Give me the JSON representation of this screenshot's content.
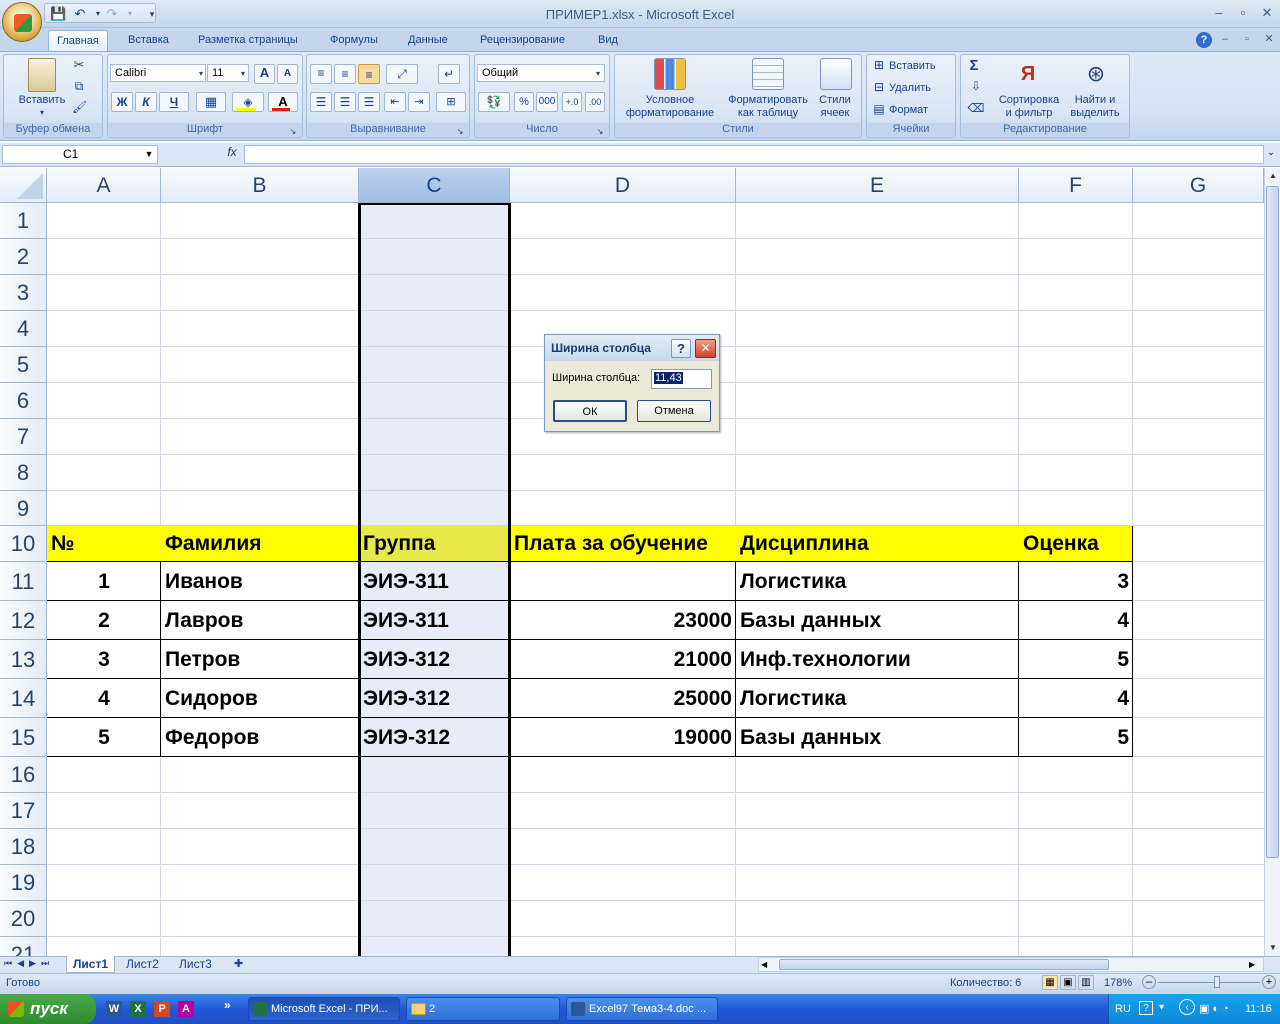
{
  "window": {
    "title": "ПРИМЕР1.xlsx - Microsoft Excel"
  },
  "ribbon": {
    "tabs": [
      "Главная",
      "Вставка",
      "Разметка страницы",
      "Формулы",
      "Данные",
      "Рецензирование",
      "Вид"
    ],
    "clipboard": {
      "paste": "Вставить",
      "label": "Буфер обмена"
    },
    "font": {
      "name": "Calibri",
      "size": "11",
      "bold": "Ж",
      "italic": "К",
      "underline": "Ч",
      "grow": "A",
      "shrink": "A",
      "color_letter": "A",
      "label": "Шрифт"
    },
    "alignment": {
      "label": "Выравнивание"
    },
    "number": {
      "format": "Общий",
      "percent": "%",
      "thousands": "000",
      "label": "Число"
    },
    "styles": {
      "conditional_1": "Условное",
      "conditional_2": "форматирование",
      "table_1": "Форматировать",
      "table_2": "как таблицу",
      "cell_1": "Стили",
      "cell_2": "ячеек",
      "label": "Стили"
    },
    "cells": {
      "insert": "Вставить",
      "delete": "Удалить",
      "format": "Формат",
      "label": "Ячейки"
    },
    "editing": {
      "sum": "Σ",
      "sort_1": "Сортировка",
      "sort_2": "и фильтр",
      "find_1": "Найти и",
      "find_2": "выделить",
      "label": "Редактирование"
    }
  },
  "formula_bar": {
    "name_box": "C1",
    "fx": "fx",
    "formula": ""
  },
  "columns": [
    "A",
    "B",
    "C",
    "D",
    "E",
    "F",
    "G"
  ],
  "rows": [
    "1",
    "2",
    "3",
    "4",
    "5",
    "6",
    "7",
    "8",
    "9",
    "10",
    "11",
    "12",
    "13",
    "14",
    "15",
    "16",
    "17",
    "18",
    "19",
    "20",
    "21"
  ],
  "table": {
    "headers": [
      "№",
      "Фамилия",
      "Группа",
      "Плата за обучение",
      "Дисциплина",
      "Оценка"
    ],
    "rows": [
      [
        "1",
        "Иванов",
        "ЭИЭ-311",
        "",
        "Логистика",
        "3"
      ],
      [
        "2",
        "Лавров",
        "ЭИЭ-311",
        "23000",
        "Базы данных",
        "4"
      ],
      [
        "3",
        "Петров",
        "ЭИЭ-312",
        "21000",
        "Инф.технологии",
        "5"
      ],
      [
        "4",
        "Сидоров",
        "ЭИЭ-312",
        "25000",
        "Логистика",
        "4"
      ],
      [
        "5",
        "Федоров",
        "ЭИЭ-312",
        "19000",
        "Базы данных",
        "5"
      ]
    ]
  },
  "dialog": {
    "title": "Ширина столбца",
    "help": "?",
    "close": "✕",
    "field_label": "Ширина столбца:",
    "field_value": "11,43",
    "ok": "ОК",
    "cancel": "Отмена"
  },
  "sheets": [
    "Лист1",
    "Лист2",
    "Лист3"
  ],
  "status": {
    "ready": "Готово",
    "count": "Количество: 6",
    "zoom": "178%"
  },
  "taskbar": {
    "start": "пуск",
    "buttons": [
      "Microsoft Excel - ПРИ...",
      "2",
      "Excel97 Тема3-4.doc ..."
    ],
    "lang": "RU",
    "clock": "11:16"
  },
  "colors": {
    "header_fill": "#ffff00",
    "selected_column": "#e8ecf6",
    "accent": "#15428b"
  }
}
